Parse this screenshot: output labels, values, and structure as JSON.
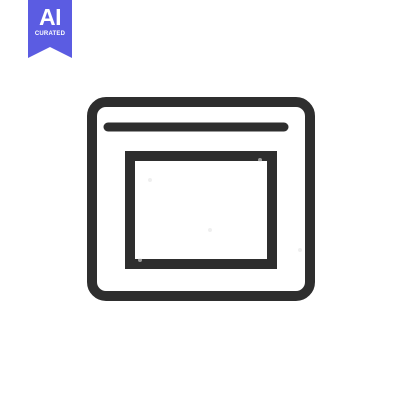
{
  "badge": {
    "title": "AI",
    "subtitle": "CURATED",
    "color": "#5b5ce2"
  },
  "icon": {
    "name": "browser-window-icon",
    "stroke_color": "#2e2e2e"
  }
}
